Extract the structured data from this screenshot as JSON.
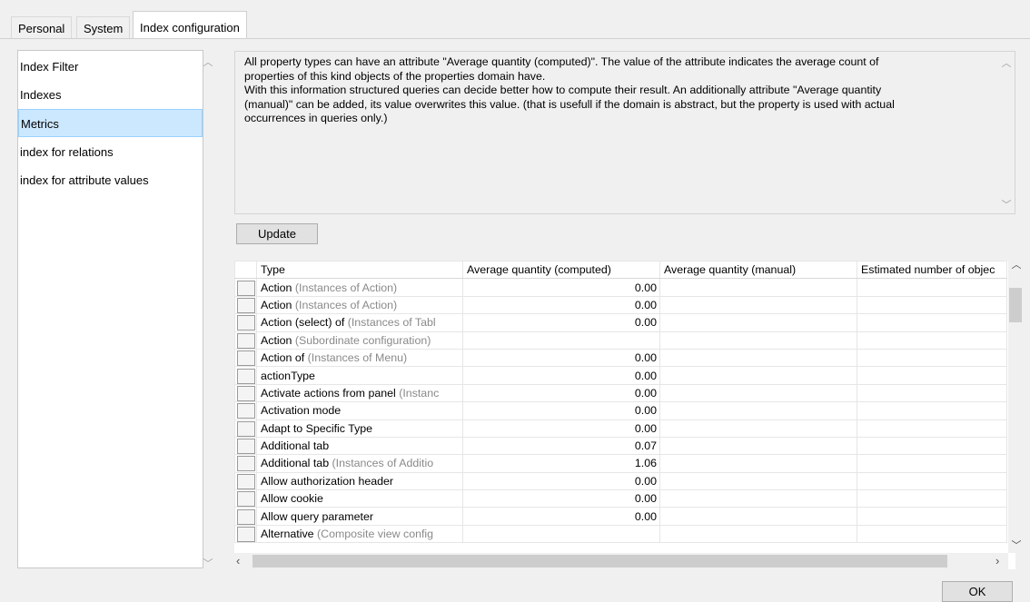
{
  "tabs": [
    {
      "label": "Personal"
    },
    {
      "label": "System"
    },
    {
      "label": "Index configuration"
    }
  ],
  "left_list": {
    "items": [
      {
        "label": "Index Filter"
      },
      {
        "label": "Indexes"
      },
      {
        "label": "Metrics"
      },
      {
        "label": "index for relations"
      },
      {
        "label": "index for attribute values"
      }
    ],
    "selected": "Metrics"
  },
  "description": "All property types can have an attribute \"Average quantity (computed)\". The value of the attribute indicates the average count of\nproperties of this kind objects of the properties domain have.\nWith this information structured queries can decide better how to compute their result. An additionally attribute \"Average quantity\n(manual)\" can be added, its value overwrites this value. (that is usefull if the domain is abstract, but the property is used with actual\noccurrences in queries only.)",
  "update_label": "Update",
  "ok_label": "OK",
  "table": {
    "columns": [
      "Type",
      "Average quantity (computed)",
      "Average quantity (manual)",
      "Estimated number of objec"
    ],
    "rows": [
      {
        "name": "Action",
        "detail": " (Instances of Action)",
        "computed": "0.00"
      },
      {
        "name": "Action",
        "detail": " (Instances of Action)",
        "computed": "0.00"
      },
      {
        "name": "Action (select) of",
        "detail": " (Instances of Tabl",
        "computed": "0.00"
      },
      {
        "name": "Action",
        "detail": " (Subordinate configuration)",
        "computed": ""
      },
      {
        "name": "Action of",
        "detail": " (Instances of Menu)",
        "computed": "0.00"
      },
      {
        "name": "actionType",
        "detail": "",
        "computed": "0.00"
      },
      {
        "name": "Activate actions from panel",
        "detail": " (Instanc",
        "computed": "0.00"
      },
      {
        "name": "Activation mode",
        "detail": "",
        "computed": "0.00"
      },
      {
        "name": "Adapt to Specific Type",
        "detail": "",
        "computed": "0.00"
      },
      {
        "name": "Additional tab",
        "detail": "",
        "computed": "0.07"
      },
      {
        "name": "Additional tab",
        "detail": " (Instances of Additio",
        "computed": "1.06"
      },
      {
        "name": "Allow authorization header",
        "detail": "",
        "computed": "0.00"
      },
      {
        "name": "Allow cookie",
        "detail": "",
        "computed": "0.00"
      },
      {
        "name": "Allow query parameter",
        "detail": "",
        "computed": "0.00"
      },
      {
        "name": "Alternative",
        "detail": " (Composite view config",
        "computed": ""
      }
    ]
  }
}
